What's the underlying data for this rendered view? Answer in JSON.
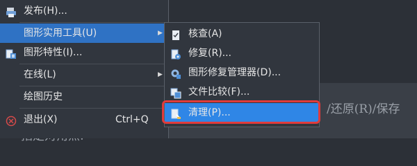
{
  "command_line": {
    "prompt_fragment": "/还原(R)/保存",
    "next_prompt": "指定对角点:"
  },
  "main_menu": {
    "items": [
      {
        "label": "发布(H)...",
        "shortcut": "",
        "has_submenu": false,
        "icon": "publish-icon"
      },
      {
        "label": "图形实用工具(U)",
        "shortcut": "",
        "has_submenu": true,
        "icon": ""
      },
      {
        "label": "图形特性(I)...",
        "shortcut": "",
        "has_submenu": false,
        "icon": "drawing-properties-icon"
      },
      {
        "label": "在线(L)",
        "shortcut": "",
        "has_submenu": true,
        "icon": ""
      },
      {
        "label": "绘图历史",
        "shortcut": "",
        "has_submenu": false,
        "icon": ""
      },
      {
        "label": "退出(X)",
        "shortcut": "Ctrl+Q",
        "has_submenu": false,
        "icon": "exit-icon"
      }
    ],
    "arrow_glyph": "▶"
  },
  "submenu": {
    "items": [
      {
        "label": "核查(A)",
        "icon": "audit-icon"
      },
      {
        "label": "修复(R)...",
        "icon": "recover-icon"
      },
      {
        "label": "图形修复管理器(D)...",
        "icon": "drawing-recovery-manager-icon"
      },
      {
        "label": "文件比较(F)...",
        "icon": "file-compare-icon"
      },
      {
        "label": "清理(P)...",
        "icon": "purge-icon"
      }
    ]
  },
  "colors": {
    "active_item": "#2f72c4",
    "highlight_item": "#2f86e6",
    "callout_frame": "#e03b3b"
  }
}
